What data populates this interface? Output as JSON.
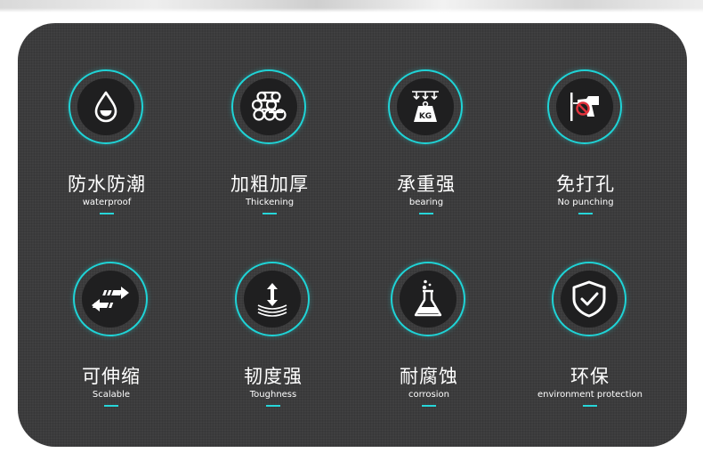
{
  "accent_color": "#1fd3d6",
  "panel_color": "#3c3c3d",
  "features": [
    {
      "title": "防水防潮",
      "subtitle": "waterproof",
      "icon": "water-drop-icon"
    },
    {
      "title": "加粗加厚",
      "subtitle": "Thickening",
      "icon": "pipes-bundle-icon"
    },
    {
      "title": "承重强",
      "subtitle": "bearing",
      "icon": "weight-bearing-icon",
      "icon_text": "KG"
    },
    {
      "title": "免打孔",
      "subtitle": "No punching",
      "icon": "no-drill-icon"
    },
    {
      "title": "可伸缩",
      "subtitle": "Scalable",
      "icon": "telescopic-arrows-icon"
    },
    {
      "title": "韧度强",
      "subtitle": "Toughness",
      "icon": "flex-arrow-icon"
    },
    {
      "title": "耐腐蚀",
      "subtitle": "corrosion",
      "icon": "flask-icon"
    },
    {
      "title": "环保",
      "subtitle": "environment protection",
      "icon": "shield-check-icon"
    }
  ]
}
